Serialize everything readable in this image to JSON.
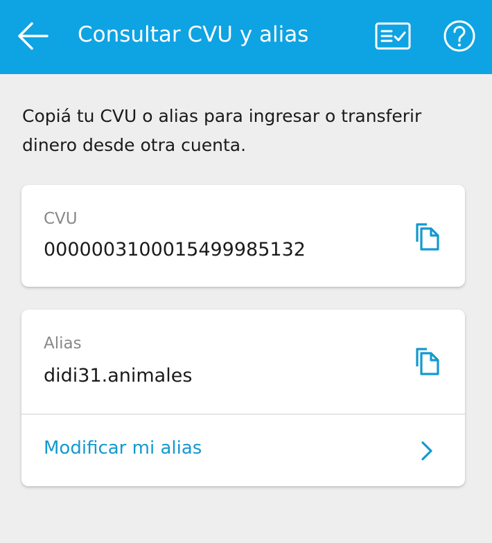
{
  "header": {
    "title": "Consultar CVU y alias",
    "back_icon": "arrow-left-icon",
    "receipt_icon": "receipt-check-icon",
    "help_icon": "question-circle-icon",
    "background_color": "#0ea3e3"
  },
  "intro_text": "Copiá tu CVU o alias para ingresar o transferir dinero desde otra cuenta.",
  "cvu_card": {
    "label": "CVU",
    "value": "0000003100015499985132",
    "copy_icon": "copy-icon"
  },
  "alias_card": {
    "label": "Alias",
    "value": "didi31.animales",
    "copy_icon": "copy-icon",
    "modify_label": "Modificar mi alias",
    "modify_icon": "chevron-right-icon",
    "link_color": "#1399cf"
  }
}
